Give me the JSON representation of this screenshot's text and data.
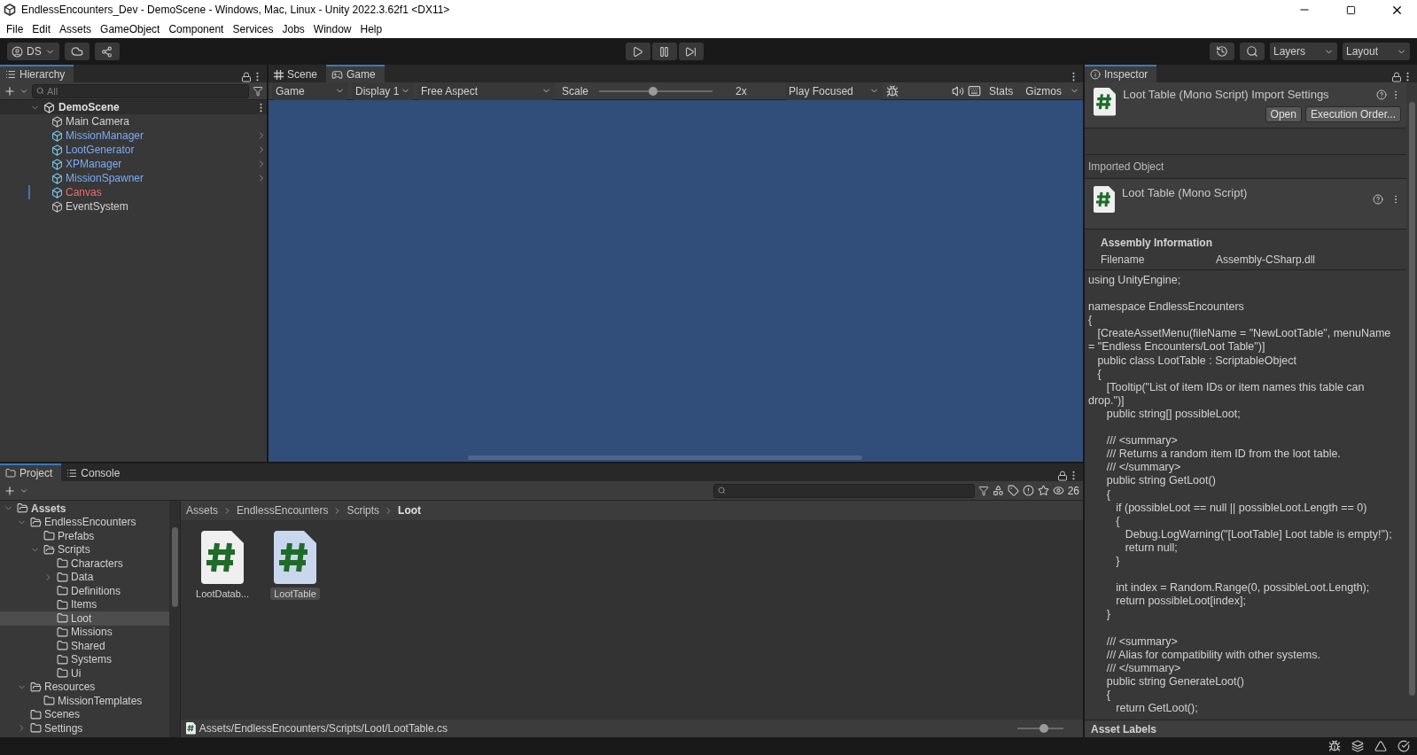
{
  "window": {
    "title": "EndlessEncounters_Dev - DemoScene - Windows, Mac, Linux - Unity 2022.3.62f1 <DX11>"
  },
  "menu": [
    "File",
    "Edit",
    "Assets",
    "GameObject",
    "Component",
    "Services",
    "Jobs",
    "Window",
    "Help"
  ],
  "toolbar": {
    "account": "DS",
    "layers": "Layers",
    "layout": "Layout"
  },
  "hierarchy": {
    "tab": "Hierarchy",
    "search_placeholder": "All",
    "scene": {
      "name": "DemoScene",
      "expanded": true,
      "children": [
        {
          "name": "Main Camera",
          "kind": "object",
          "expandable": false,
          "changed": false
        },
        {
          "name": "MissionManager",
          "kind": "prefab",
          "expandable": true,
          "changed": false
        },
        {
          "name": "LootGenerator",
          "kind": "prefab",
          "expandable": true,
          "changed": false
        },
        {
          "name": "XPManager",
          "kind": "prefab",
          "expandable": true,
          "changed": false
        },
        {
          "name": "MissionSpawner",
          "kind": "prefab",
          "expandable": true,
          "changed": false
        },
        {
          "name": "Canvas",
          "kind": "missing-prefab",
          "expandable": false,
          "changed": true
        },
        {
          "name": "EventSystem",
          "kind": "object",
          "expandable": false,
          "changed": false
        }
      ]
    }
  },
  "view_tabs": [
    {
      "label": "Scene",
      "kind": "scene",
      "selected": false
    },
    {
      "label": "Game",
      "kind": "game",
      "selected": true
    }
  ],
  "game_toolbar": {
    "mode": "Game",
    "display": "Display 1",
    "aspect": "Free Aspect",
    "scale_label": "Scale",
    "scale": {
      "level": 0.48
    },
    "scale_reading": "2x",
    "play_mode": "Play Focused",
    "stats": "Stats",
    "gizmos": "Gizmos"
  },
  "project": {
    "tabs": [
      {
        "label": "Project",
        "kind": "project",
        "selected": true
      },
      {
        "label": "Console",
        "kind": "console",
        "selected": false
      }
    ],
    "count": "26",
    "tree": [
      {
        "name": "Assets",
        "expandable": true,
        "expanded": true,
        "selected": false,
        "children": [
          {
            "name": "EndlessEncounters",
            "expandable": true,
            "expanded": true,
            "selected": false,
            "children": [
              {
                "name": "Prefabs",
                "expandable": false,
                "expanded": false,
                "selected": false
              },
              {
                "name": "Scripts",
                "expandable": true,
                "expanded": true,
                "selected": false,
                "children": [
                  {
                    "name": "Characters",
                    "expandable": false,
                    "expanded": false,
                    "selected": false
                  },
                  {
                    "name": "Data",
                    "expandable": true,
                    "expanded": false,
                    "selected": false
                  },
                  {
                    "name": "Definitions",
                    "expandable": false,
                    "expanded": false,
                    "selected": false
                  },
                  {
                    "name": "Items",
                    "expandable": false,
                    "expanded": false,
                    "selected": false
                  },
                  {
                    "name": "Loot",
                    "expandable": false,
                    "expanded": false,
                    "selected": true
                  },
                  {
                    "name": "Missions",
                    "expandable": false,
                    "expanded": false,
                    "selected": false
                  },
                  {
                    "name": "Shared",
                    "expandable": false,
                    "expanded": false,
                    "selected": false
                  },
                  {
                    "name": "Systems",
                    "expandable": false,
                    "expanded": false,
                    "selected": false
                  },
                  {
                    "name": "Ui",
                    "expandable": false,
                    "expanded": false,
                    "selected": false
                  }
                ]
              }
            ]
          },
          {
            "name": "Resources",
            "expandable": true,
            "expanded": true,
            "selected": false,
            "children": [
              {
                "name": "MissionTemplates",
                "expandable": false,
                "expanded": false,
                "selected": false
              }
            ]
          },
          {
            "name": "Scenes",
            "expandable": false,
            "expanded": false,
            "selected": false
          },
          {
            "name": "Settings",
            "expandable": true,
            "expanded": false,
            "selected": false
          }
        ]
      }
    ],
    "breadcrumbs": [
      "Assets",
      "EndlessEncounters",
      "Scripts",
      "Loot"
    ],
    "files": [
      {
        "name": "LootDatab...",
        "selected": false
      },
      {
        "name": "LootTable",
        "selected": true
      }
    ],
    "path": "Assets/EndlessEncounters/Scripts/Loot/LootTable.cs",
    "icon_size": {
      "level": 0.58
    }
  },
  "inspector": {
    "tab": "Inspector",
    "header_title": "Loot Table (Mono Script) Import Settings",
    "buttons": [
      "Open",
      "Execution Order..."
    ],
    "section_label": "Imported Object",
    "component_title": "Loot Table (Mono Script)",
    "assembly_heading": "Assembly Information",
    "filename_label": "Filename",
    "filename_value": "Assembly-CSharp.dll",
    "source": "using UnityEngine;\n\nnamespace EndlessEncounters\n{\n   [CreateAssetMenu(fileName = \"NewLootTable\", menuName = \"Endless Encounters/Loot Table\")]\n   public class LootTable : ScriptableObject\n   {\n      [Tooltip(\"List of item IDs or item names this table can drop.\")]\n      public string[] possibleLoot;\n\n      /// <summary>\n      /// Returns a random item ID from the loot table.\n      /// </summary>\n      public string GetLoot()\n      {\n         if (possibleLoot == null || possibleLoot.Length == 0)\n         {\n            Debug.LogWarning(\"[LootTable] Loot table is empty!\");\n            return null;\n         }\n\n         int index = Random.Range(0, possibleLoot.Length);\n         return possibleLoot[index];\n      }\n\n      /// <summary>\n      /// Alias for compatibility with other systems.\n      /// </summary>\n      public string GenerateLoot()\n      {\n         return GetLoot();",
    "labels_heading": "Asset Labels"
  }
}
